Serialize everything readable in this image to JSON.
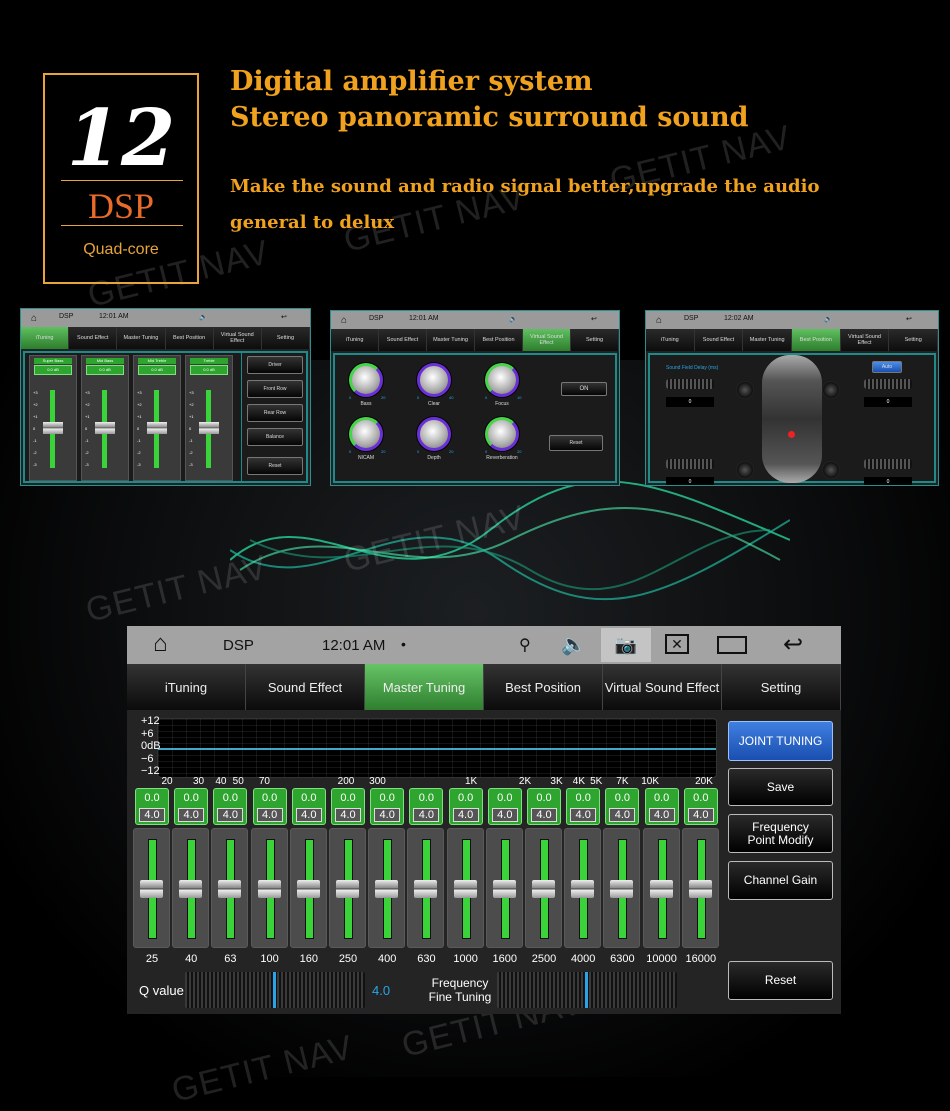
{
  "brand": {
    "number": "12",
    "dsp": "DSP",
    "subtitle": "Quad-core",
    "accent": "#e8a33a",
    "headline_color": "#f0a21e"
  },
  "headline": {
    "line1": "Digital amplifier system",
    "line2": "Stereo panoramic surround sound",
    "desc1": "Make the sound and radio signal better,upgrade the audio",
    "desc2": "general to delux"
  },
  "watermark": "GETIT NAV",
  "tabs": [
    "iTuning",
    "Sound Effect",
    "Master Tuning",
    "Best Position",
    "Virtual Sound Effect",
    "Setting"
  ],
  "mini1": {
    "title": "DSP",
    "time": "12:01 AM",
    "active_tab": 0,
    "channels": [
      {
        "name": "Super Bass",
        "value": "0.0 dB"
      },
      {
        "name": "Mid Bass",
        "value": "0.0 dB"
      },
      {
        "name": "Mid Treble",
        "value": "0.0 dB"
      },
      {
        "name": "Treble",
        "value": "0.0 dB"
      }
    ],
    "scale": [
      "+3",
      "+2",
      "+1",
      "0",
      "-1",
      "-2",
      "-3"
    ],
    "buttons": [
      "Driver",
      "Front Row",
      "Rear Row",
      "Balance",
      "Reset"
    ]
  },
  "mini2": {
    "title": "DSP",
    "time": "12:01 AM",
    "active_tab": 4,
    "knobs": [
      {
        "name": "Bass",
        "min": "0",
        "max": "20"
      },
      {
        "name": "Clear",
        "min": "0",
        "max": "40"
      },
      {
        "name": "Focus",
        "min": "0",
        "max": "10"
      },
      {
        "name": "NICAM",
        "min": "0",
        "max": "20"
      },
      {
        "name": "Depth",
        "min": "0",
        "max": "20"
      },
      {
        "name": "Reverberation",
        "min": "0",
        "max": "20"
      }
    ],
    "toggle": "ON",
    "reset": "Reset"
  },
  "mini3": {
    "title": "DSP",
    "time": "12:02 AM",
    "active_tab": 3,
    "label": "Sound Field Delay (ms)",
    "auto": "Auto",
    "delays": [
      "0",
      "0",
      "0",
      "0"
    ]
  },
  "main": {
    "title": "DSP",
    "time": "12:01 AM",
    "dot": "•",
    "active_tab": 2,
    "y_labels": [
      "+12",
      "+6",
      "0dB",
      "−6",
      "−12"
    ],
    "freq_ticks": [
      "20",
      "30",
      "40",
      "50",
      "70",
      "200",
      "300",
      "1K",
      "2K",
      "3K",
      "4K",
      "5K",
      "7K",
      "10K",
      "20K"
    ],
    "bands": [
      {
        "freq": "25",
        "gain": "0.0",
        "q": "4.0"
      },
      {
        "freq": "40",
        "gain": "0.0",
        "q": "4.0"
      },
      {
        "freq": "63",
        "gain": "0.0",
        "q": "4.0"
      },
      {
        "freq": "100",
        "gain": "0.0",
        "q": "4.0"
      },
      {
        "freq": "160",
        "gain": "0.0",
        "q": "4.0"
      },
      {
        "freq": "250",
        "gain": "0.0",
        "q": "4.0"
      },
      {
        "freq": "400",
        "gain": "0.0",
        "q": "4.0"
      },
      {
        "freq": "630",
        "gain": "0.0",
        "q": "4.0"
      },
      {
        "freq": "1000",
        "gain": "0.0",
        "q": "4.0"
      },
      {
        "freq": "1600",
        "gain": "0.0",
        "q": "4.0"
      },
      {
        "freq": "2500",
        "gain": "0.0",
        "q": "4.0"
      },
      {
        "freq": "4000",
        "gain": "0.0",
        "q": "4.0"
      },
      {
        "freq": "6300",
        "gain": "0.0",
        "q": "4.0"
      },
      {
        "freq": "10000",
        "gain": "0.0",
        "q": "4.0"
      },
      {
        "freq": "16000",
        "gain": "0.0",
        "q": "4.0"
      }
    ],
    "q_label": "Q value",
    "q_value": "4.0",
    "fine_label_1": "Frequency",
    "fine_label_2": "Fine Tuning",
    "buttons": {
      "joint": "JOINT TUNING",
      "save": "Save",
      "freq1": "Frequency",
      "freq2": "Point Modify",
      "gain": "Channel Gain",
      "reset": "Reset"
    }
  }
}
